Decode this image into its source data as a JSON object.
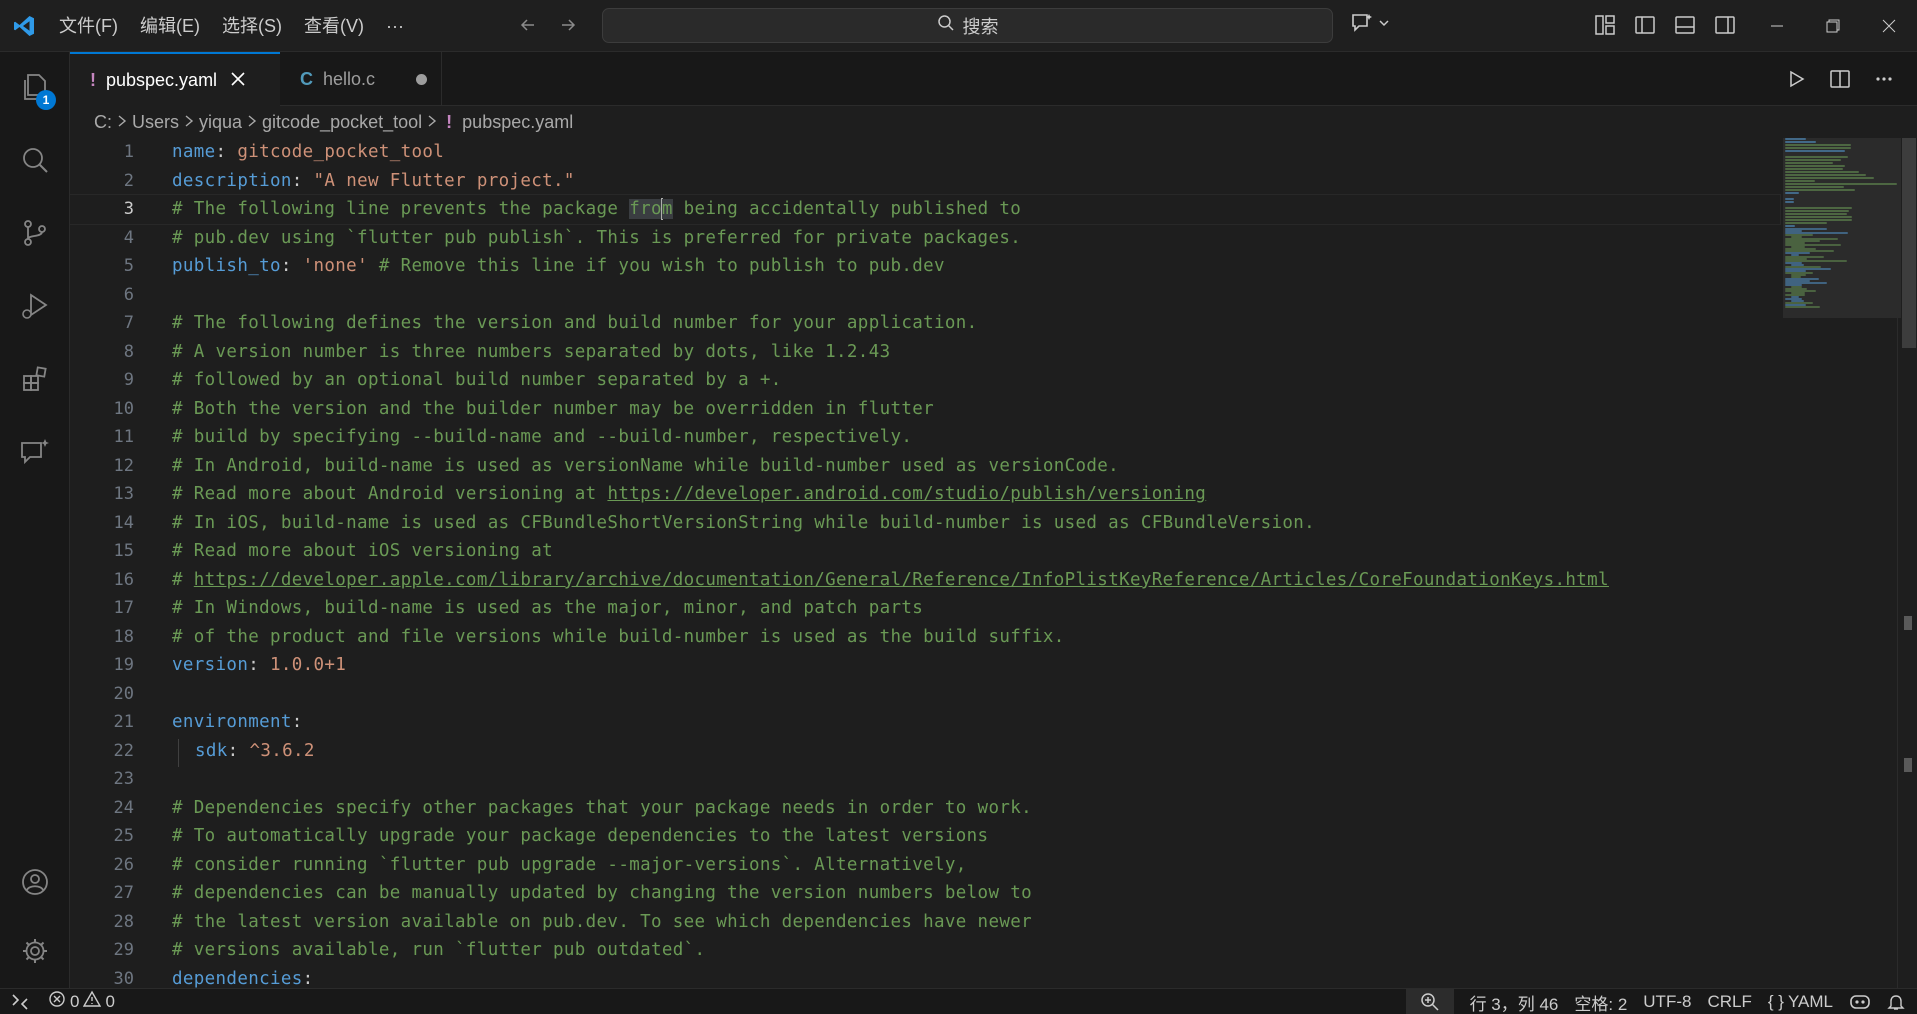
{
  "titlebar": {
    "menu": [
      "文件(F)",
      "编辑(E)",
      "选择(S)",
      "查看(V)",
      "···"
    ],
    "search_label": "搜索"
  },
  "activity_bar": {
    "items": [
      "explorer-icon",
      "search-icon",
      "source-control-icon",
      "run-debug-icon",
      "extensions-icon",
      "chat-icon"
    ],
    "explorer_badge": "1",
    "bottom": [
      "account-icon",
      "manage-gear-icon"
    ]
  },
  "tabs": [
    {
      "icon": "!",
      "label": "pubspec.yaml",
      "active": true
    },
    {
      "icon": "C",
      "label": "hello.c",
      "active": false,
      "dirty": true
    }
  ],
  "breadcrumb": [
    "C:",
    "Users",
    "yiqua",
    "gitcode_pocket_tool",
    "pubspec.yaml"
  ],
  "editor": {
    "current_line": 3,
    "lines": [
      {
        "n": "1"
      },
      {
        "n": "2"
      },
      {
        "n": "3"
      },
      {
        "n": "4"
      },
      {
        "n": "5"
      },
      {
        "n": "6"
      },
      {
        "n": "7"
      },
      {
        "n": "8"
      },
      {
        "n": "9"
      },
      {
        "n": "10"
      },
      {
        "n": "11"
      },
      {
        "n": "12"
      },
      {
        "n": "13"
      },
      {
        "n": "14"
      },
      {
        "n": "15"
      },
      {
        "n": "16"
      },
      {
        "n": "17"
      },
      {
        "n": "18"
      },
      {
        "n": "19"
      },
      {
        "n": "20"
      },
      {
        "n": "21"
      },
      {
        "n": "22"
      },
      {
        "n": "23"
      },
      {
        "n": "24"
      },
      {
        "n": "25"
      },
      {
        "n": "26"
      },
      {
        "n": "27"
      },
      {
        "n": "28"
      },
      {
        "n": "29"
      },
      {
        "n": "30"
      }
    ],
    "code": {
      "l1_key": "name",
      "l1_colon": ": ",
      "l1_val": "gitcode_pocket_tool",
      "l2_key": "description",
      "l2_colon": ": ",
      "l2_val": "\"A new Flutter project.\"",
      "l3_a": "# The following line prevents the package ",
      "l3_hl_a": "fro",
      "l3_hl_b": "m",
      "l3_b": " being accidentally published to",
      "l4": "# pub.dev using `flutter pub publish`. This is preferred for private packages.",
      "l5_key": "publish_to",
      "l5_colon": ": ",
      "l5_val": "'none'",
      "l5_comment": " # Remove this line if you wish to publish to pub.dev",
      "l7": "# The following defines the version and build number for your application.",
      "l8": "# A version number is three numbers separated by dots, like 1.2.43",
      "l9": "# followed by an optional build number separated by a +.",
      "l10": "# Both the version and the builder number may be overridden in flutter",
      "l11": "# build by specifying --build-name and --build-number, respectively.",
      "l12": "# In Android, build-name is used as versionName while build-number used as versionCode.",
      "l13_a": "# Read more about Android versioning at ",
      "l13_url": "https://developer.android.com/studio/publish/versioning",
      "l14": "# In iOS, build-name is used as CFBundleShortVersionString while build-number is used as CFBundleVersion.",
      "l15": "# Read more about iOS versioning at",
      "l16_a": "# ",
      "l16_url": "https://developer.apple.com/library/archive/documentation/General/Reference/InfoPlistKeyReference/Articles/CoreFoundationKeys.html",
      "l17": "# In Windows, build-name is used as the major, minor, and patch parts",
      "l18": "# of the product and file versions while build-number is used as the build suffix.",
      "l19_key": "version",
      "l19_colon": ": ",
      "l19_val": "1.0.0+1",
      "l21_key": "environment",
      "l21_colon": ":",
      "l22_key": "sdk",
      "l22_colon": ": ",
      "l22_val": "^3.6.2",
      "l24": "# Dependencies specify other packages that your package needs in order to work.",
      "l25": "# To automatically upgrade your package dependencies to the latest versions",
      "l26": "# consider running `flutter pub upgrade --major-versions`. Alternatively,",
      "l27": "# dependencies can be manually updated by changing the version numbers below to",
      "l28": "# the latest version available on pub.dev. To see which dependencies have newer",
      "l29": "# versions available, run `flutter pub outdated`.",
      "l30_key": "dependencies",
      "l30_colon": ":"
    }
  },
  "statusbar": {
    "errors": "0",
    "warnings": "0",
    "position": "行 3，列 46",
    "spaces": "空格: 2",
    "encoding": "UTF-8",
    "eol": "CRLF",
    "language_braces": "{ }",
    "language": "YAML"
  },
  "colors": {
    "accent": "#0078d4",
    "keyword": "#569cd6",
    "string": "#ce9178",
    "comment": "#6a9955",
    "background": "#1e1e1e"
  }
}
